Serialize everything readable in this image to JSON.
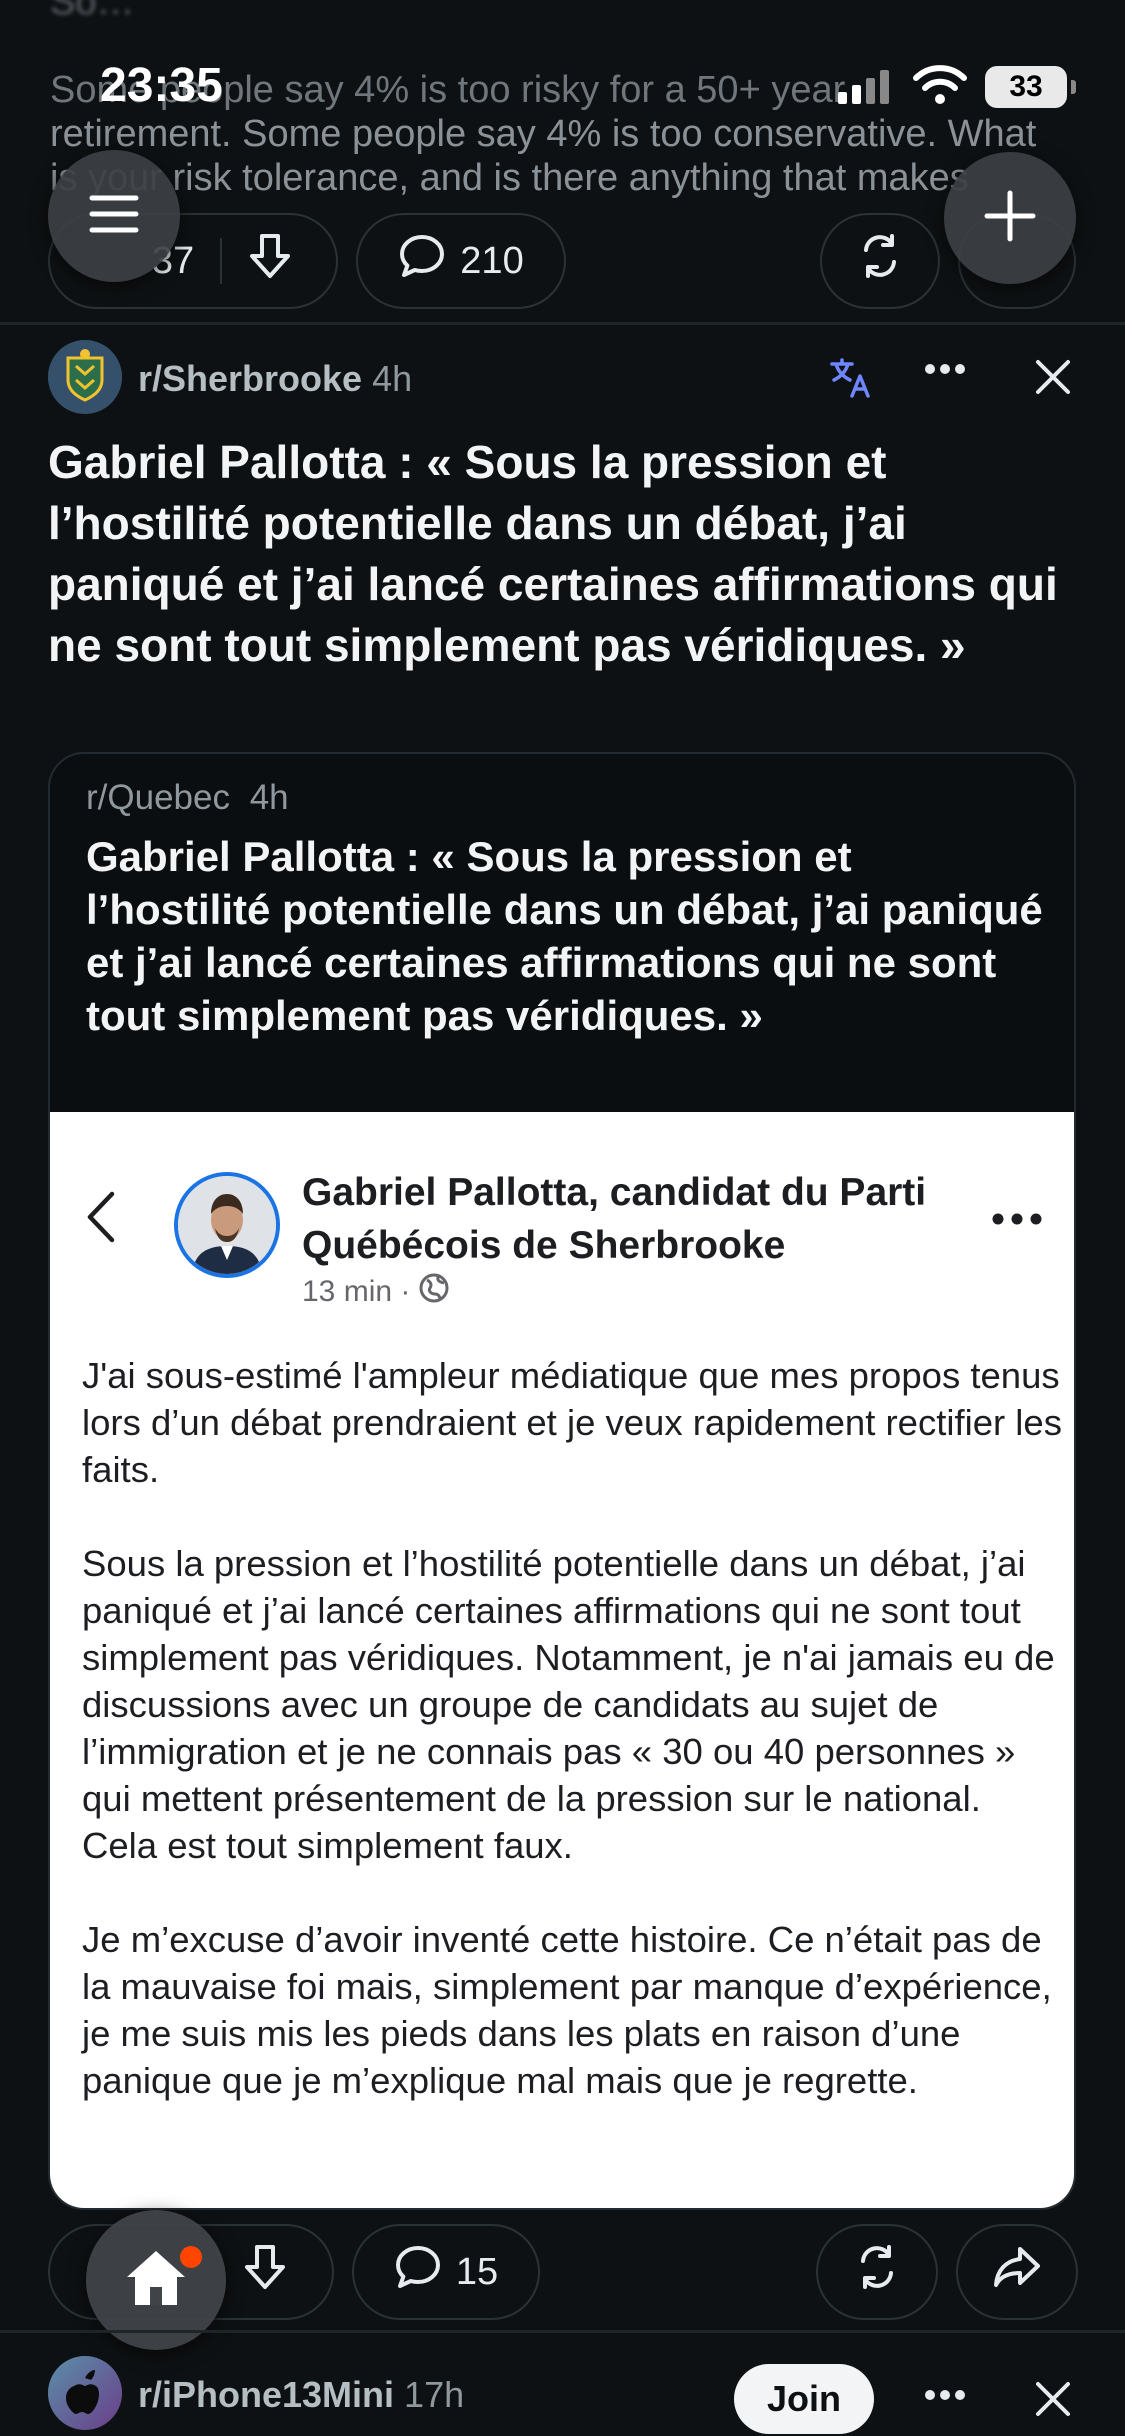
{
  "status_bar": {
    "time": "23:35",
    "battery": "33"
  },
  "prev_post": {
    "line0": "So…",
    "line1": "Some people say 4% is too risky for a 50+ year",
    "line2": "retirement. Some people say 4% is too conservative. What",
    "line3": "is your risk tolerance, and is there anything that makes",
    "vote_count": "37",
    "comment_count": "210"
  },
  "post": {
    "subreddit": "r/Sherbrooke",
    "age": "4h",
    "title": "Gabriel Pallotta : « Sous la pression et l’hostilité potentielle dans un débat, j’ai paniqué et j’ai lancé certaines affirmations qui ne sont tout simplement pas véridiques. »",
    "crosspost": {
      "subreddit": "r/Quebec",
      "age": "4h",
      "title": "Gabriel Pallotta : « Sous la pression et l’hostilité potentielle dans un débat, j’ai paniqué et j’ai lancé certaines affirmations qui ne sont tout simplement pas véridiques. »"
    },
    "facebook": {
      "author": "Gabriel Pallotta, candidat du Parti Québécois de Sherbrooke",
      "time": "13 min ·",
      "paragraphs": [
        "J'ai sous-estimé l'ampleur médiatique que mes propos tenus lors d’un débat prendraient et je veux rapidement rectifier les faits.",
        "Sous la pression et l’hostilité potentielle dans un débat, j’ai paniqué et j’ai lancé certaines affirmations qui ne sont tout simplement pas véridiques. Notamment, je n'ai jamais eu de discussions avec un groupe de candidats au sujet de l’immigration et je ne connais pas « 30 ou 40 personnes » qui mettent présentement de la pression sur le national. Cela est tout simplement faux.",
        "Je m’excuse d’avoir inventé cette histoire. Ce n’était pas de la mauvaise foi mais, simplement par manque d’expérience, je me suis mis les pieds dans les plats en raison d’une panique que je m’explique mal mais que je regrette."
      ]
    },
    "comment_count": "15"
  },
  "next_post": {
    "subreddit": "r/iPhone13Mini",
    "age": "17h",
    "join_label": "Join"
  },
  "colors": {
    "background": "#0e1113",
    "accent": "#ff4500",
    "translate": "#6f86ff",
    "fb_blue": "#1b74e4"
  },
  "icons": [
    "menu-icon",
    "plus-icon",
    "upvote-icon",
    "downvote-icon",
    "comment-icon",
    "award-icon",
    "share-icon",
    "translate-icon",
    "more-icon",
    "close-icon",
    "home-icon",
    "back-icon",
    "globe-icon"
  ]
}
